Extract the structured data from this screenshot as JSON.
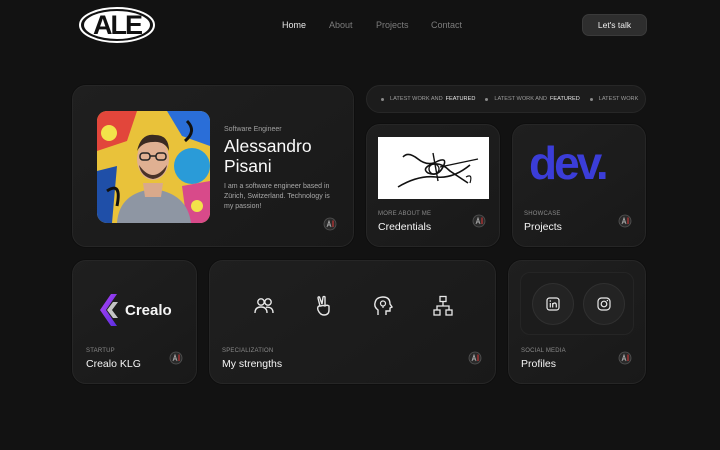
{
  "brand": {
    "logo_text": "ALE"
  },
  "nav": {
    "items": [
      {
        "label": "Home",
        "active": true
      },
      {
        "label": "About",
        "active": false
      },
      {
        "label": "Projects",
        "active": false
      },
      {
        "label": "Contact",
        "active": false
      }
    ],
    "cta_label": "Let's talk"
  },
  "hero": {
    "role": "Software Engineer",
    "name_line1": "Alessandro",
    "name_line2": "Pisani",
    "bio": "I am a software engineer based in Zürich, Switzerland. Technology is my passion!"
  },
  "ticker": {
    "items": [
      {
        "text": "LATEST WORK AND",
        "strong": "FEATURED"
      },
      {
        "text": "LATEST WORK AND",
        "strong": "FEATURED"
      },
      {
        "text": "LATEST WORK",
        "strong": ""
      }
    ]
  },
  "cards": {
    "credentials": {
      "eyebrow": "MORE ABOUT ME",
      "title": "Credentials"
    },
    "projects": {
      "eyebrow": "SHOWCASE",
      "title": "Projects",
      "logo_text": "dev."
    },
    "crealo": {
      "eyebrow": "STARTUP",
      "title": "Crealo KLG",
      "logo_text": "Crealo"
    },
    "strengths": {
      "eyebrow": "SPECIALIZATION",
      "title": "My strengths",
      "icons": [
        "people-icon",
        "peace-hand-icon",
        "head-idea-icon",
        "hierarchy-icon"
      ]
    },
    "profiles": {
      "eyebrow": "SOCIAL MEDIA",
      "title": "Profiles",
      "icons": [
        "linkedin-icon",
        "instagram-icon"
      ]
    }
  },
  "colors": {
    "background": "#121212",
    "card": "#1d1d1d",
    "dev_blue": "#3b3dd8",
    "crealo_purple": "#8b3cf0"
  }
}
